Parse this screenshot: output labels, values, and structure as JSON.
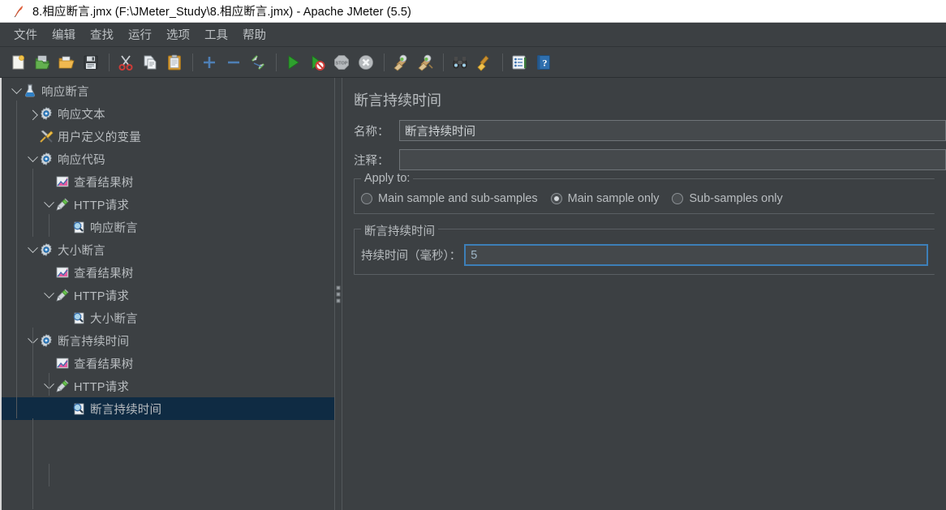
{
  "window": {
    "title": "8.相应断言.jmx (F:\\JMeter_Study\\8.相应断言.jmx) - Apache JMeter (5.5)",
    "app_icon": "jmeter-feather-icon"
  },
  "menubar": {
    "items": [
      {
        "label": "文件",
        "name": "menu-file"
      },
      {
        "label": "编辑",
        "name": "menu-edit"
      },
      {
        "label": "查找",
        "name": "menu-search"
      },
      {
        "label": "运行",
        "name": "menu-run"
      },
      {
        "label": "选项",
        "name": "menu-options"
      },
      {
        "label": "工具",
        "name": "menu-tools"
      },
      {
        "label": "帮助",
        "name": "menu-help"
      }
    ]
  },
  "toolbar": {
    "buttons": [
      {
        "icon": "new-document-icon",
        "group": 1
      },
      {
        "icon": "templates-icon",
        "group": 1
      },
      {
        "icon": "open-folder-icon",
        "group": 1
      },
      {
        "icon": "save-floppy-icon",
        "group": 1
      },
      {
        "icon": "cut-scissors-icon",
        "group": 2
      },
      {
        "icon": "copy-icon",
        "group": 2
      },
      {
        "icon": "paste-clipboard-icon",
        "group": 2
      },
      {
        "icon": "expand-plus-icon",
        "group": 3
      },
      {
        "icon": "collapse-minus-icon",
        "group": 3
      },
      {
        "icon": "toggle-enable-icon",
        "group": 3
      },
      {
        "icon": "start-play-icon",
        "group": 4
      },
      {
        "icon": "start-no-pauses-icon",
        "group": 4
      },
      {
        "icon": "stop-icon",
        "group": 4
      },
      {
        "icon": "shutdown-icon",
        "group": 4
      },
      {
        "icon": "clear-broom-icon",
        "group": 5
      },
      {
        "icon": "clear-all-broom-icon",
        "group": 5
      },
      {
        "icon": "search-binoculars-icon",
        "group": 6
      },
      {
        "icon": "reset-search-broom-icon",
        "group": 6
      },
      {
        "icon": "function-helper-icon",
        "group": 7
      },
      {
        "icon": "help-icon",
        "group": 7
      }
    ]
  },
  "tree": {
    "nodes": [
      {
        "label": "响应断言",
        "depth": 0,
        "icon": "test-plan-flask-icon",
        "toggle": "down",
        "selected": false
      },
      {
        "label": "响应文本",
        "depth": 1,
        "icon": "thread-group-gear-icon",
        "toggle": "right",
        "selected": false
      },
      {
        "label": "用户定义的变量",
        "depth": 1,
        "icon": "config-tools-icon",
        "toggle": "none",
        "selected": false
      },
      {
        "label": "响应代码",
        "depth": 1,
        "icon": "thread-group-gear-icon",
        "toggle": "down",
        "selected": false
      },
      {
        "label": "查看结果树",
        "depth": 2,
        "icon": "view-results-tree-icon",
        "toggle": "none",
        "selected": false
      },
      {
        "label": "HTTP请求",
        "depth": 2,
        "icon": "http-sampler-icon",
        "toggle": "down",
        "selected": false
      },
      {
        "label": "响应断言",
        "depth": 3,
        "icon": "assertion-magnifier-icon",
        "toggle": "none",
        "selected": false
      },
      {
        "label": "大小断言",
        "depth": 1,
        "icon": "thread-group-gear-icon",
        "toggle": "down",
        "selected": false
      },
      {
        "label": "查看结果树",
        "depth": 2,
        "icon": "view-results-tree-icon",
        "toggle": "none",
        "selected": false
      },
      {
        "label": "HTTP请求",
        "depth": 2,
        "icon": "http-sampler-icon",
        "toggle": "down",
        "selected": false
      },
      {
        "label": "大小断言",
        "depth": 3,
        "icon": "assertion-magnifier-icon",
        "toggle": "none",
        "selected": false
      },
      {
        "label": "断言持续时间",
        "depth": 1,
        "icon": "thread-group-gear-icon",
        "toggle": "down",
        "selected": false
      },
      {
        "label": "查看结果树",
        "depth": 2,
        "icon": "view-results-tree-icon",
        "toggle": "none",
        "selected": false
      },
      {
        "label": "HTTP请求",
        "depth": 2,
        "icon": "http-sampler-icon",
        "toggle": "down",
        "selected": false
      },
      {
        "label": "断言持续时间",
        "depth": 3,
        "icon": "assertion-magnifier-icon",
        "toggle": "none",
        "selected": true
      }
    ]
  },
  "main": {
    "panel_title": "断言持续时间",
    "name_label": "名称：",
    "name_value": "断言持续时间",
    "comment_label": "注释：",
    "comment_value": "",
    "comment_placeholder": "",
    "apply_to": {
      "group_title": "Apply to:",
      "options": [
        {
          "label": "Main sample and sub-samples",
          "checked": false
        },
        {
          "label": "Main sample only",
          "checked": true
        },
        {
          "label": "Sub-samples only",
          "checked": false
        }
      ]
    },
    "duration": {
      "group_title": "断言持续时间",
      "field_label": "持续时间（毫秒）：",
      "value": "5"
    }
  },
  "colors": {
    "background": "#3c4043",
    "panel_text": "#b9bdc0",
    "selection": "#0f2b43",
    "focus_border": "#3d7fb8",
    "titlebar_bg": "#ffffff",
    "field_bg": "#45494c",
    "field_border": "#6f7478"
  }
}
